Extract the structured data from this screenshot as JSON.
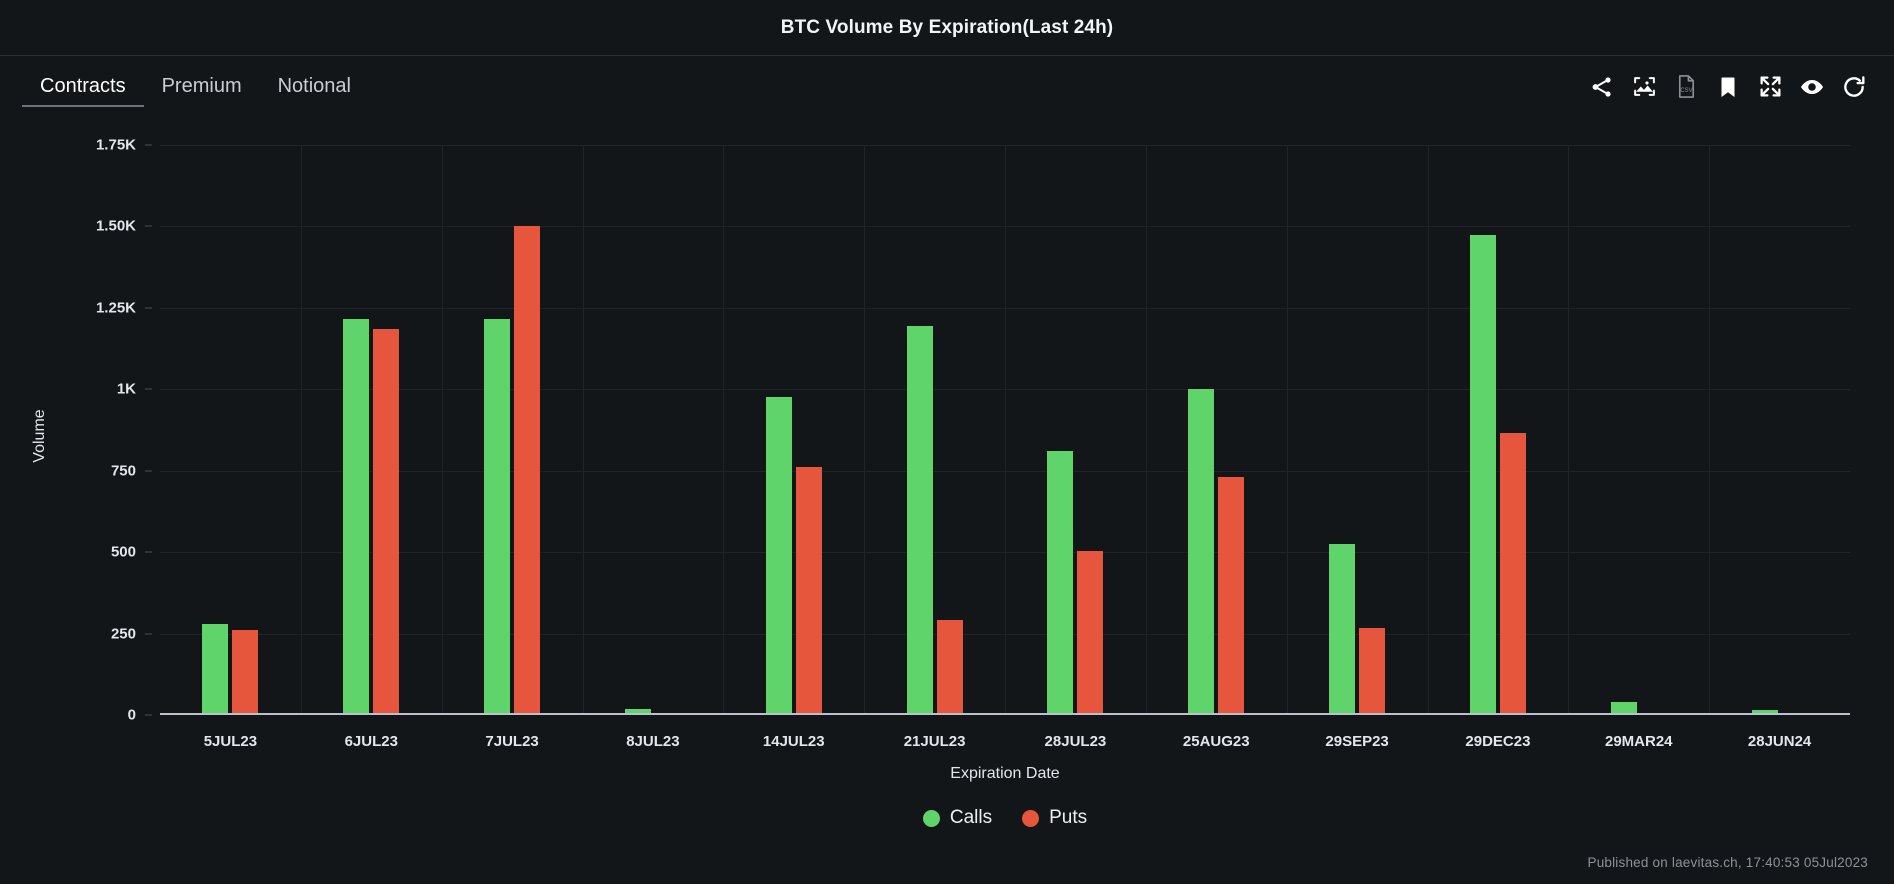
{
  "header": {
    "title": "BTC Volume By Expiration(Last 24h)"
  },
  "tabs": [
    {
      "label": "Contracts",
      "active": true
    },
    {
      "label": "Premium",
      "active": false
    },
    {
      "label": "Notional",
      "active": false
    }
  ],
  "toolbar_icons": [
    {
      "name": "share-icon",
      "label": "Share"
    },
    {
      "name": "image-export-icon",
      "label": "Save image"
    },
    {
      "name": "csv-export-icon",
      "label": "CSV",
      "text": "CSV"
    },
    {
      "name": "bookmark-icon",
      "label": "Bookmark"
    },
    {
      "name": "fullscreen-icon",
      "label": "Fullscreen"
    },
    {
      "name": "eye-icon",
      "label": "Watch"
    },
    {
      "name": "refresh-icon",
      "label": "Refresh"
    }
  ],
  "footer": {
    "published": "Published on laevitas.ch, 17:40:53 05Jul2023"
  },
  "colors": {
    "calls": "#5ed46a",
    "puts": "#e5563c",
    "background": "#131619",
    "grid": "#1f2429",
    "axis": "#b9c2cc",
    "text": "#e3e6ea"
  },
  "chart_data": {
    "type": "bar",
    "title": "BTC Volume By Expiration(Last 24h)",
    "xlabel": "Expiration Date",
    "ylabel": "Volume",
    "ylim": [
      0,
      1750
    ],
    "grid": true,
    "legend_position": "bottom",
    "ytick_values": [
      0,
      250,
      500,
      750,
      1000,
      1250,
      1500,
      1750
    ],
    "ytick_labels": [
      "0",
      "250",
      "500",
      "750",
      "1K",
      "1.25K",
      "1.50K",
      "1.75K"
    ],
    "categories": [
      "5JUL23",
      "6JUL23",
      "7JUL23",
      "8JUL23",
      "14JUL23",
      "21JUL23",
      "28JUL23",
      "25AUG23",
      "29SEP23",
      "29DEC23",
      "29MAR24",
      "28JUN24"
    ],
    "series": [
      {
        "name": "Calls",
        "color": "#5ed46a",
        "values": [
          280,
          1215,
          1215,
          18,
          975,
          1195,
          810,
          1000,
          525,
          1475,
          40,
          15
        ]
      },
      {
        "name": "Puts",
        "color": "#e5563c",
        "values": [
          262,
          1185,
          1500,
          3,
          760,
          292,
          505,
          730,
          268,
          865,
          0,
          4
        ]
      }
    ]
  }
}
